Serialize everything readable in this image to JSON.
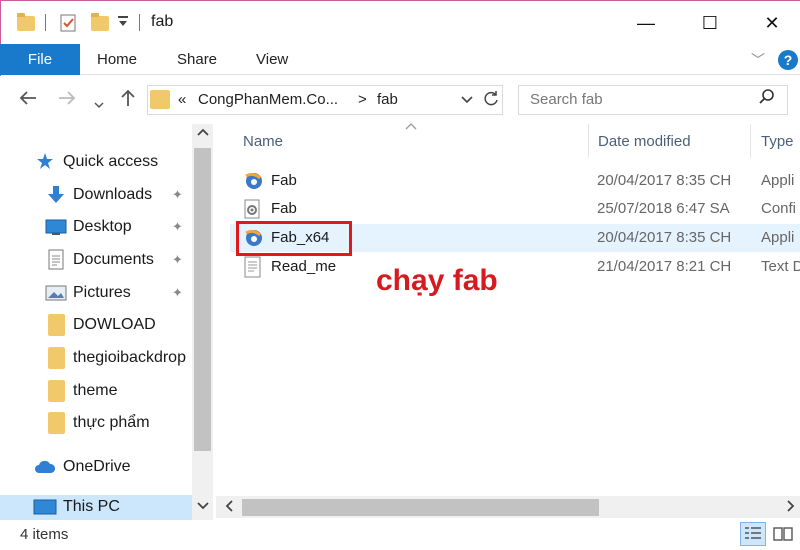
{
  "window": {
    "title": "fab",
    "minimize_glyph": "—",
    "maximize_glyph": "☐",
    "close_glyph": "✕"
  },
  "ribbon": {
    "tabs": [
      "File",
      "Home",
      "Share",
      "View"
    ],
    "help_glyph": "?"
  },
  "address_bar": {
    "prefix": "«",
    "crumbs": [
      "CongPhanMem.Co...",
      "fab"
    ],
    "separator": ">"
  },
  "search": {
    "placeholder": "Search fab"
  },
  "nav_pane": {
    "quick_access": "Quick access",
    "items": [
      {
        "label": "Downloads",
        "icon": "download-arrow-icon",
        "pinned": true
      },
      {
        "label": "Desktop",
        "icon": "desktop-icon",
        "pinned": true
      },
      {
        "label": "Documents",
        "icon": "documents-icon",
        "pinned": true
      },
      {
        "label": "Pictures",
        "icon": "pictures-icon",
        "pinned": true
      },
      {
        "label": "DOWLOAD",
        "icon": "folder-icon",
        "pinned": false
      },
      {
        "label": "thegioibackdrop",
        "icon": "folder-icon",
        "pinned": false
      },
      {
        "label": "theme",
        "icon": "folder-icon",
        "pinned": false
      },
      {
        "label": "thực phẩm",
        "icon": "folder-icon",
        "pinned": false
      }
    ],
    "onedrive": "OneDrive",
    "this_pc": "This PC"
  },
  "columns": {
    "name": "Name",
    "date": "Date modified",
    "type": "Type"
  },
  "files": [
    {
      "name": "Fab",
      "date": "20/04/2017 8:35 CH",
      "type": "Appli",
      "icon": "application-icon"
    },
    {
      "name": "Fab",
      "date": "25/07/2018 6:47 SA",
      "type": "Confi",
      "icon": "config-file-icon"
    },
    {
      "name": "Fab_x64",
      "date": "20/04/2017 8:35 CH",
      "type": "Appli",
      "icon": "application-icon"
    },
    {
      "name": "Read_me",
      "date": "21/04/2017 8:21 CH",
      "type": "Text D",
      "icon": "text-file-icon"
    }
  ],
  "annotation": {
    "text": "chạy fab",
    "color": "#d61a1f"
  },
  "status": {
    "item_count": "4 items"
  },
  "colors": {
    "accent": "#1979ca",
    "hover_row": "#e5f3ff",
    "selected_nav": "#cce6fb",
    "folder": "#f1c96a"
  }
}
